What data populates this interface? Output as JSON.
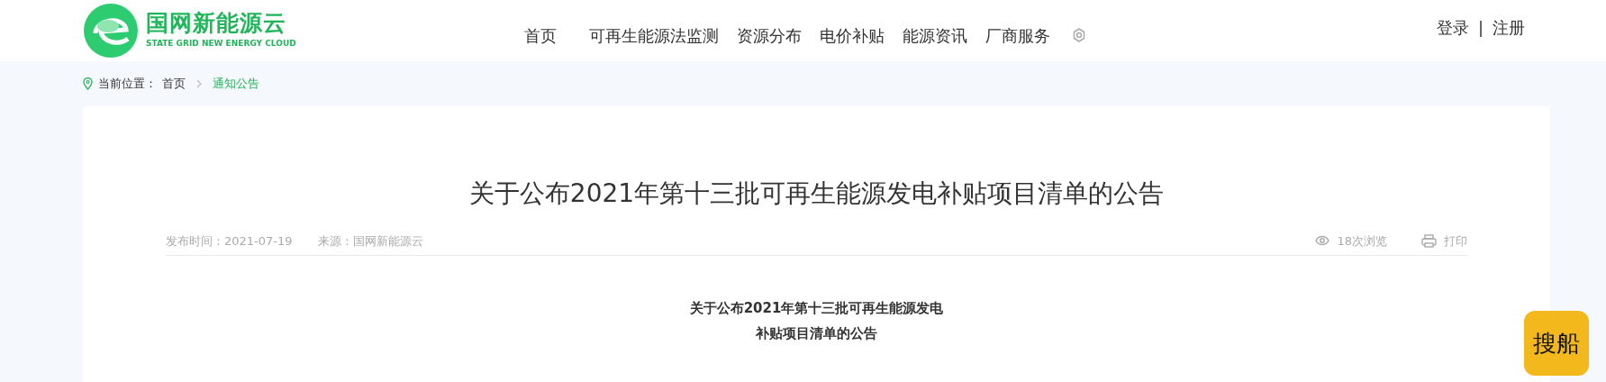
{
  "header": {
    "logo": {
      "name": "国网新能源云",
      "subtitle": "STATE GRID NEW ENERGY CLOUD"
    },
    "nav": [
      {
        "label": "首页",
        "selected": false
      },
      {
        "label": "可再生能源法监测",
        "selected": false
      },
      {
        "label": "资源分布",
        "selected": false
      },
      {
        "label": "电价补贴",
        "selected": false
      },
      {
        "label": "能源资讯",
        "selected": false
      },
      {
        "label": "厂商服务",
        "selected": false
      }
    ],
    "auth": {
      "login": "登录",
      "separator": "|",
      "register": "注册"
    }
  },
  "breadcrumb": {
    "label": "当前位置：",
    "items": [
      {
        "label": "首页",
        "current": false
      },
      {
        "label": "通知公告",
        "current": true
      }
    ]
  },
  "article": {
    "title": "关于公布2021年第十三批可再生能源发电补贴项目清单的公告",
    "publish_time": "发布时间：2021-07-19",
    "source": "来源：国网新能源云",
    "views": "18次浏览",
    "print": "打印",
    "body_heading": [
      "关于公布2021年第十三批可再生能源发电",
      "补贴项目清单的公告"
    ]
  },
  "floating_button": {
    "label": "搜船"
  }
}
